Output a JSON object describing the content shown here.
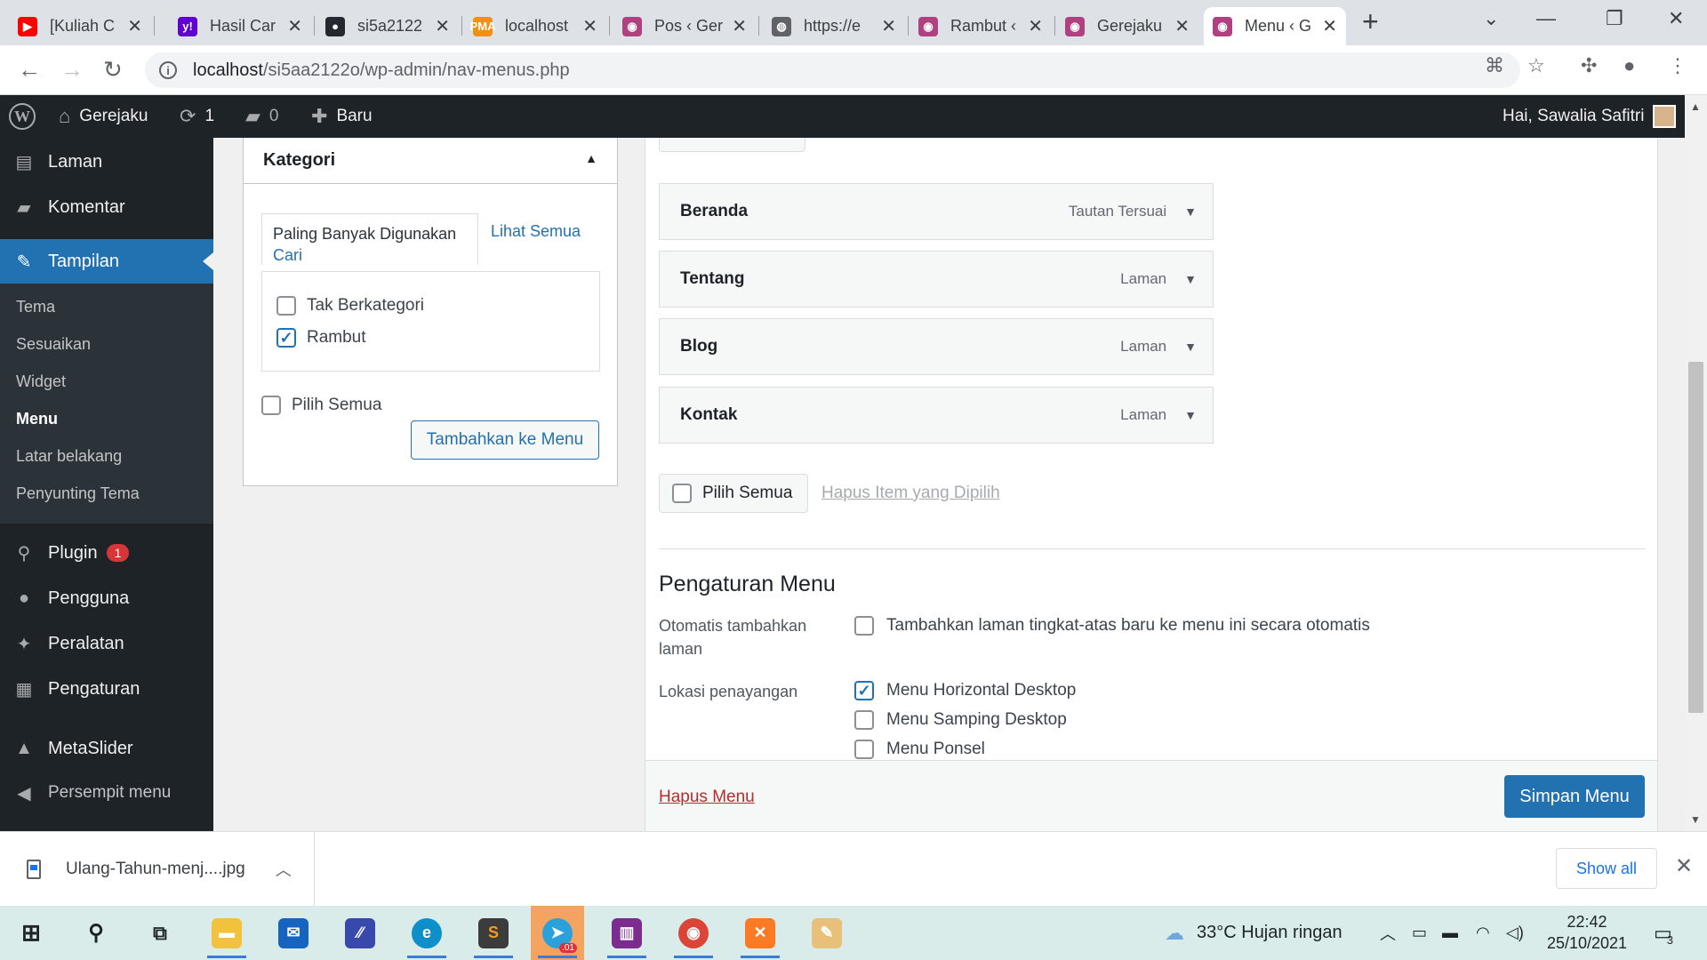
{
  "browser": {
    "tabs": [
      {
        "title": "[Kuliah C",
        "favicon": "youtube-icon",
        "color": "#ff0000",
        "glyph": "▶"
      },
      {
        "title": "Hasil Car",
        "favicon": "yahoo-icon",
        "color": "#6001d2",
        "glyph": "y!"
      },
      {
        "title": "si5a2122",
        "favicon": "github-icon",
        "color": "#24292f",
        "glyph": "●"
      },
      {
        "title": "localhost",
        "favicon": "phpmyadmin-icon",
        "color": "#f29111",
        "glyph": "PMA"
      },
      {
        "title": "Pos ‹ Ger",
        "favicon": "site-icon",
        "color": "#b04080",
        "glyph": "◉"
      },
      {
        "title": "https://e",
        "favicon": "globe-icon",
        "color": "#5f6368",
        "glyph": "◍"
      },
      {
        "title": "Rambut ‹",
        "favicon": "site-icon",
        "color": "#b04080",
        "glyph": "◉"
      },
      {
        "title": "Gerejaku",
        "favicon": "site-icon",
        "color": "#b04080",
        "glyph": "◉"
      },
      {
        "title": "Menu ‹ G",
        "favicon": "site-icon",
        "color": "#b04080",
        "glyph": "◉",
        "active": true
      }
    ],
    "url_host": "localhost",
    "url_path": "/si5aa2122o/wp-admin/nav-menus.php"
  },
  "adminbar": {
    "site_name": "Gerejaku",
    "updates_count": "1",
    "comments_count": "0",
    "new_label": "Baru",
    "greeting": "Hai, Sawalia Safitri"
  },
  "sidebar": {
    "items_top": [
      {
        "label": "Laman",
        "icon": "pages-icon"
      },
      {
        "label": "Komentar",
        "icon": "comments-icon"
      }
    ],
    "active": {
      "label": "Tampilan",
      "icon": "paintbrush-icon"
    },
    "submenu": [
      "Tema",
      "Sesuaikan",
      "Widget",
      "Menu",
      "Latar belakang",
      "Penyunting Tema"
    ],
    "submenu_current": "Menu",
    "items_bottom": [
      {
        "label": "Plugin",
        "icon": "plugin-icon",
        "badge": "1"
      },
      {
        "label": "Pengguna",
        "icon": "users-icon"
      },
      {
        "label": "Peralatan",
        "icon": "tools-icon"
      },
      {
        "label": "Pengaturan",
        "icon": "settings-icon"
      },
      {
        "label": "MetaSlider",
        "icon": "metaslider-icon"
      },
      {
        "label": "Persempit menu",
        "icon": "collapse-icon"
      }
    ]
  },
  "kategori": {
    "title": "Kategori",
    "tab_most_used": "Paling Banyak Digunakan",
    "tab_all": "Lihat Semua",
    "tab_search": "Cari",
    "options": [
      {
        "label": "Tak Berkategori",
        "checked": false
      },
      {
        "label": "Rambut",
        "checked": true
      }
    ],
    "select_all": "Pilih Semua",
    "add_button": "Tambahkan ke Menu"
  },
  "menu_structure": {
    "items": [
      {
        "name": "Beranda",
        "type": "Tautan Tersuai"
      },
      {
        "name": "Tentang",
        "type": "Laman"
      },
      {
        "name": "Blog",
        "type": "Laman"
      },
      {
        "name": "Kontak",
        "type": "Laman"
      }
    ],
    "bulk_select_all": "Pilih Semua",
    "remove_selected": "Hapus Item yang Dipilih"
  },
  "menu_settings": {
    "title": "Pengaturan Menu",
    "auto_add_label": "Otomatis tambahkan laman",
    "auto_add_option": "Tambahkan laman tingkat-atas baru ke menu ini secara otomatis",
    "auto_add_checked": false,
    "location_label": "Lokasi penayangan",
    "locations": [
      {
        "label": "Menu Horizontal Desktop",
        "checked": true
      },
      {
        "label": "Menu Samping Desktop",
        "checked": false
      },
      {
        "label": "Menu Ponsel",
        "checked": false
      }
    ],
    "delete_menu": "Hapus Menu",
    "save_menu": "Simpan Menu"
  },
  "download_bar": {
    "filename": "Ulang-Tahun-menj....jpg",
    "show_all": "Show all"
  },
  "taskbar": {
    "weather": "33°C  Hujan ringan",
    "time": "22:42",
    "date": "25/10/2021",
    "notifications": "3",
    "telegram_badge": ".01"
  },
  "colors": {
    "wp_blue": "#2271b1",
    "admin_dark": "#1d2327",
    "danger": "#b32d2e"
  }
}
